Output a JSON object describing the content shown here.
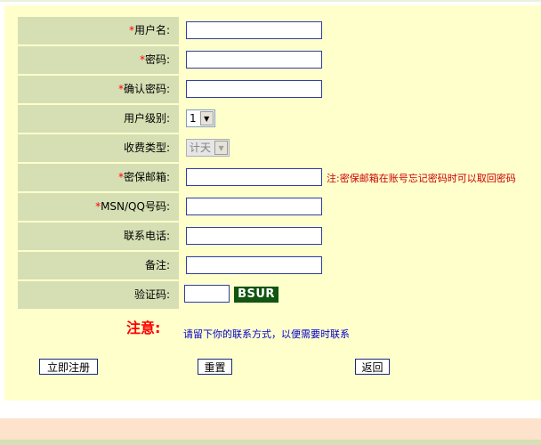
{
  "form": {
    "username": {
      "required": "*",
      "label": "用户名:",
      "value": ""
    },
    "password": {
      "required": "*",
      "label": "密码:",
      "value": ""
    },
    "confirm_password": {
      "required": "*",
      "label": "确认密码:",
      "value": ""
    },
    "user_level": {
      "required": "",
      "label": "用户级别:",
      "selected": "1"
    },
    "fee_type": {
      "required": "",
      "label": "收费类型:",
      "selected": "计天"
    },
    "security_email": {
      "required": "*",
      "label": "密保邮箱:",
      "value": "",
      "note": "注:密保邮箱在账号忘记密码时可以取回密码"
    },
    "msn_qq": {
      "required": "*",
      "label": "MSN/QQ号码:",
      "value": ""
    },
    "phone": {
      "required": "",
      "label": "联系电话:",
      "value": ""
    },
    "remark": {
      "required": "",
      "label": "备注:",
      "value": ""
    },
    "captcha": {
      "required": "",
      "label": "验证码:",
      "value": "",
      "image_text": "BSUR"
    }
  },
  "attention": {
    "title": "注意:",
    "text": "请留下你的联系方式，以便需要时联系"
  },
  "buttons": {
    "register": "立即注册",
    "reset": "重置",
    "back": "返回"
  },
  "colors": {
    "label_bg": "#d6dfb3",
    "panel_bg": "#ffffcc",
    "required": "#ff0000",
    "captcha_bg": "#115511",
    "attention_text": "#0000cc"
  }
}
